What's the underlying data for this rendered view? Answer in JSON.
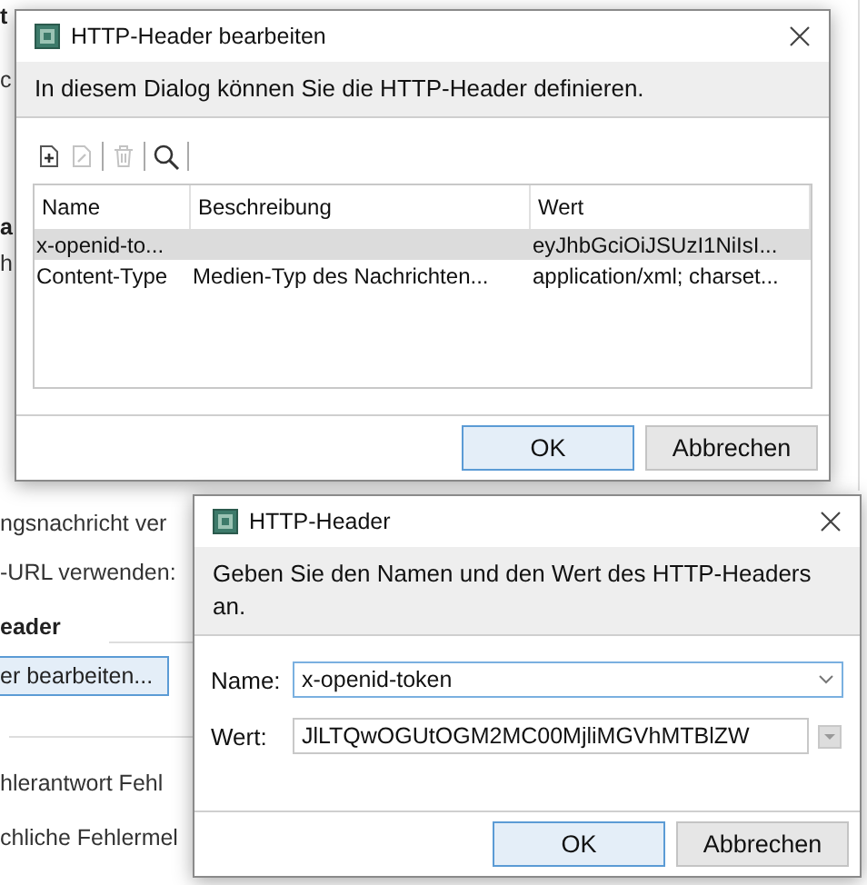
{
  "background": {
    "fragments": [
      {
        "text": "t",
        "kind": "bold"
      },
      {
        "text": "c",
        "kind": "plain"
      },
      {
        "text": "a",
        "kind": "bold"
      },
      {
        "text": "h",
        "kind": "plain"
      },
      {
        "text": "ngsnachricht ver",
        "kind": "plain"
      },
      {
        "text": "-URL verwenden:",
        "kind": "plain"
      },
      {
        "text": "eader",
        "kind": "bold"
      },
      {
        "text": "er bearbeiten...",
        "kind": "button"
      },
      {
        "text": "hlerantwort Fehl",
        "kind": "plain"
      },
      {
        "text": "chliche Fehlermel",
        "kind": "plain"
      }
    ]
  },
  "edit_dialog": {
    "title": "HTTP-Header bearbeiten",
    "message": "In diesem Dialog können Sie die HTTP-Header definieren.",
    "toolbar": [
      {
        "kind": "add",
        "disabled": false
      },
      {
        "kind": "edit",
        "disabled": true
      },
      {
        "kind": "delete",
        "disabled": true
      },
      {
        "kind": "search",
        "disabled": false
      }
    ],
    "table": {
      "columns": [
        "Name",
        "Beschreibung",
        "Wert"
      ],
      "rows": [
        {
          "cells": [
            "x-openid-to...",
            "",
            "eyJhbGciOiJSUzI1NiIsI..."
          ],
          "selected": true
        },
        {
          "cells": [
            "Content-Type",
            "Medien-Typ des Nachrichten...",
            "application/xml; charset..."
          ],
          "selected": false
        }
      ]
    },
    "buttons": [
      {
        "label": "OK",
        "default": true
      },
      {
        "label": "Abbrechen",
        "default": false
      }
    ]
  },
  "header_dialog": {
    "title": "HTTP-Header",
    "message": "Geben Sie den Namen und den Wert des HTTP-Headers an.",
    "fields": [
      {
        "label": "Name:",
        "value": "x-openid-token",
        "kind": "combo",
        "focused": true
      },
      {
        "label": "Wert:",
        "value": "JlLTQwOGUtOGM2MC00MjliMGVhMTBlZW",
        "kind": "text",
        "focused": false
      }
    ],
    "buttons": [
      {
        "label": "OK",
        "default": true
      },
      {
        "label": "Abbrechen",
        "default": false
      }
    ]
  }
}
